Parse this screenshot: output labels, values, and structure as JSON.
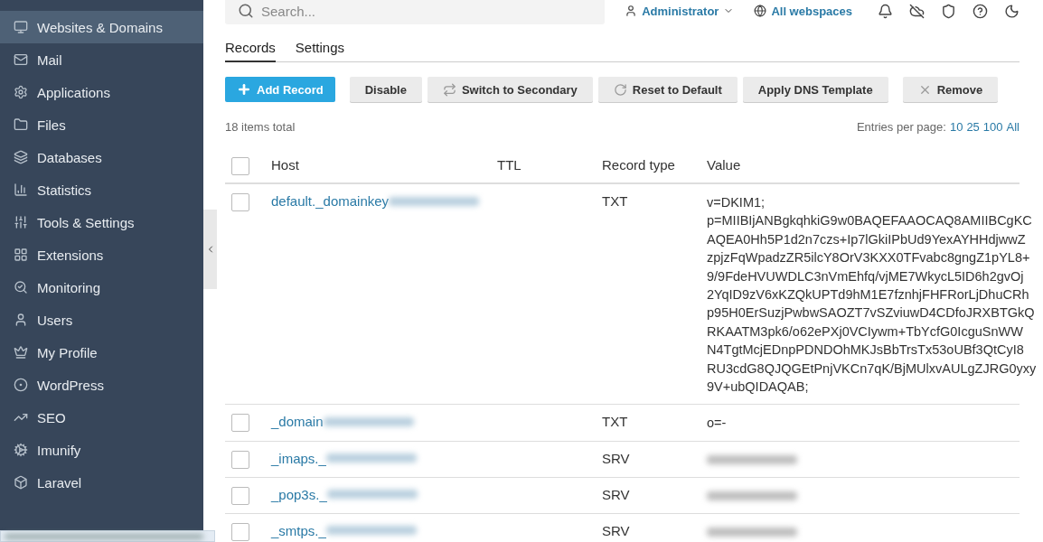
{
  "sidebar": {
    "items": [
      {
        "label": "Websites & Domains",
        "selected": true
      },
      {
        "label": "Mail",
        "selected": false
      },
      {
        "label": "Applications",
        "selected": false
      },
      {
        "label": "Files",
        "selected": false
      },
      {
        "label": "Databases",
        "selected": false
      },
      {
        "label": "Statistics",
        "selected": false
      },
      {
        "label": "Tools & Settings",
        "selected": false
      },
      {
        "label": "Extensions",
        "selected": false
      },
      {
        "label": "Monitoring",
        "selected": false
      },
      {
        "label": "Users",
        "selected": false
      },
      {
        "label": "My Profile",
        "selected": false
      },
      {
        "label": "WordPress",
        "selected": false
      },
      {
        "label": "SEO",
        "selected": false
      },
      {
        "label": "Imunify",
        "selected": false
      },
      {
        "label": "Laravel",
        "selected": false
      }
    ]
  },
  "header": {
    "search": {
      "placeholder": "Search..."
    },
    "user": "Administrator",
    "webspaces": "All webspaces"
  },
  "tabs": [
    {
      "label": "Records",
      "selected": true
    },
    {
      "label": "Settings",
      "selected": false
    }
  ],
  "toolbar": [
    {
      "label": "Add Record",
      "kind": "primary"
    },
    {
      "label": "Disable",
      "kind": "plain"
    },
    {
      "label": "Switch to Secondary",
      "kind": "plain"
    },
    {
      "label": "Reset to Default",
      "kind": "plain"
    },
    {
      "label": "Apply DNS Template",
      "kind": "plain"
    },
    {
      "label": "Remove",
      "kind": "plain"
    }
  ],
  "total": "18 items total",
  "pager": {
    "label": "Entries per page:",
    "options": [
      "10",
      "25",
      "100",
      "All"
    ]
  },
  "table": {
    "all_checked": false,
    "columns": [
      "Host",
      "TTL",
      "Record type",
      "Value"
    ],
    "rows": [
      {
        "host": "default._domainkey",
        "type": "TXT",
        "value": [
          "v=DKIM1;",
          "p=MIIBIjANBgkqhkiG9w0BAQEFAAOCAQ8AMIIBCgKC",
          "AQEA0Hh5P1d2n7czs+Ip7lGkiIPbUd9YexAYHHdjwwZ",
          "zpjzFqWpadzZR5ilcY8OrV3KXX0TFvabc8gngZ1pYL8+",
          "9/9FdeHVUWDLC3nVmEhfq/vjME7WkycL5ID6h2gvOj",
          "2YqID9zV6xKZQkUPTd9hM1E7fznhjFHFRorLjDhuCRh",
          "p95H0ErSuzjPwbwSAOZT7vSZviuwD4CDfoJRXBTGkQ",
          "RKAATM3pk6/o62ePXj0VCIywm+TbYcfG0IcguSnWW",
          "N4TgtMcjEDnpPDNDOhMKJsBbTrsTx53oUBf3QtCyI8",
          "RU3cdG8QJQGEtPnjVKCn7qK/BjMUlxvAULgZJRG0yxy",
          "9V+ubQIDAQAB;"
        ],
        "checked": false
      },
      {
        "host": "_domain",
        "type": "TXT",
        "value": [
          "o=-"
        ],
        "checked": false
      },
      {
        "host": "_imaps._",
        "type": "SRV",
        "checked": false
      },
      {
        "host": "_pop3s._",
        "type": "SRV",
        "checked": false
      },
      {
        "host": "_smtps._",
        "type": "SRV",
        "checked": false
      }
    ]
  }
}
